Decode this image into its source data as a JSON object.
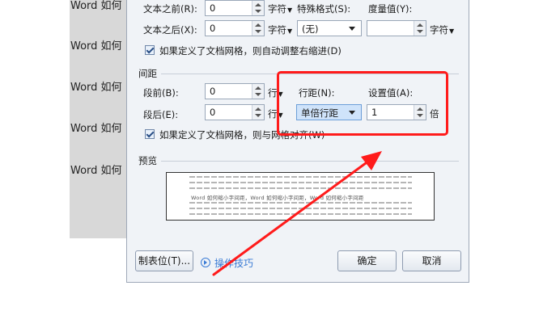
{
  "document": {
    "lines": [
      "Word 如何",
      "Word 如何",
      "Word 如何",
      "Word 如何",
      "Word 如何"
    ]
  },
  "indent": {
    "before_label": "文本之前(R):",
    "before_value": "0",
    "before_unit": "字符",
    "after_label": "文本之后(X):",
    "after_value": "0",
    "after_unit": "字符",
    "special_label": "特殊格式(S):",
    "special_value": "(无)",
    "measure_label": "度量值(Y):",
    "measure_value": "",
    "measure_unit": "字符",
    "auto_adjust_label": "如果定义了文档网格，则自动调整右缩进(D)",
    "auto_adjust_checked": true
  },
  "spacing": {
    "section_title": "间距",
    "before_label": "段前(B):",
    "before_value": "0",
    "before_unit": "行",
    "after_label": "段后(E):",
    "after_value": "0",
    "after_unit": "行",
    "line_spacing_label": "行距(N):",
    "line_spacing_value": "单倍行距",
    "set_value_label": "设置值(A):",
    "set_value": "1",
    "set_value_unit": "倍",
    "snap_grid_label": "如果定义了文档网格，则与网格对齐(W)",
    "snap_grid_checked": true
  },
  "preview": {
    "title": "预览",
    "sample_text": "Word 如何缩小字间距，Word 如何缩小字间距，Word 如何缩小字间距"
  },
  "footer": {
    "tabs_button": "制表位(T)...",
    "tips_link": "操作技巧",
    "ok_button": "确定",
    "cancel_button": "取消"
  },
  "colors": {
    "annotation_red": "#ff1b1b",
    "link_blue": "#3a7bd5",
    "dialog_bg": "#f0f3f7",
    "selected_dropdown_bg": "#cfe3fa"
  }
}
